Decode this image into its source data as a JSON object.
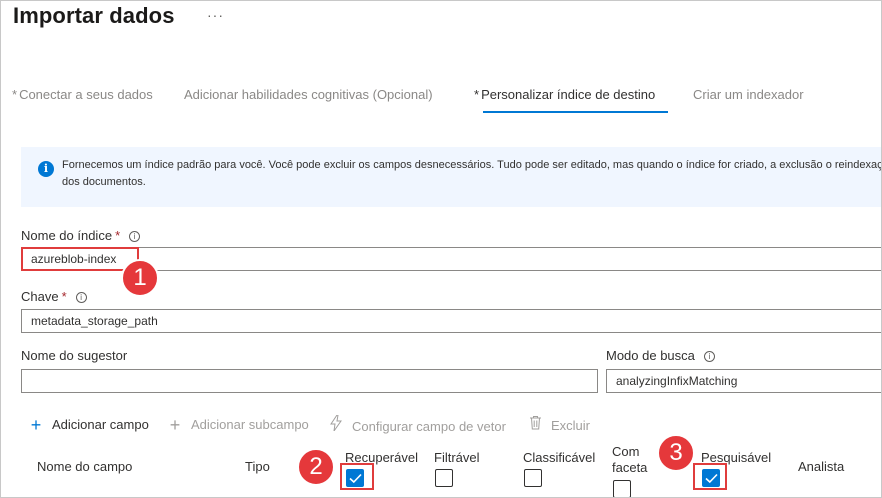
{
  "header": {
    "title": "Importar dados",
    "more_label": "···"
  },
  "steps": [
    {
      "label": "Conectar a seus dados",
      "required_mark": "*",
      "active": false
    },
    {
      "label": "Adicionar habilidades cognitivas (Opcional)",
      "active": false
    },
    {
      "label": "Personalizar índice de destino",
      "required_mark": "*",
      "active": true
    },
    {
      "label": "Criar um indexador",
      "active": false
    }
  ],
  "info_banner": {
    "icon": "info-icon",
    "icon_glyph": "i",
    "text": "Fornecemos um índice padrão para você. Você pode excluir os campos desnecessários. Tudo pode ser editado, mas quando o índice for criado, a exclusão o reindexação dos documentos."
  },
  "form": {
    "index_name": {
      "label": "Nome do índice",
      "required_mark": "*",
      "info_glyph": "i",
      "value": "azureblob-index"
    },
    "key": {
      "label": "Chave",
      "required_mark": "*",
      "info_glyph": "i",
      "value": "metadata_storage_path"
    },
    "suggester": {
      "label": "Nome do sugestor",
      "value": ""
    },
    "search_mode": {
      "label": "Modo de busca",
      "info_glyph": "i",
      "value": "analyzingInfixMatching"
    }
  },
  "toolbar": {
    "add_field": "Adicionar campo",
    "add_subfield": "Adicionar subcampo",
    "configure_vector": "Configurar campo de vetor",
    "delete": "Excluir",
    "plus_glyph": "+"
  },
  "table": {
    "columns": {
      "field_name": "Nome do campo",
      "type": "Tipo",
      "retrievable": "Recuperável",
      "filterable": "Filtrável",
      "sortable": "Classificável",
      "facetable_line1": "Com",
      "facetable_line2": "faceta",
      "searchable": "Pesquisável",
      "analyzer": "Analista"
    },
    "header_checkboxes": {
      "retrievable": true,
      "filterable": false,
      "sortable": false,
      "facetable": false,
      "searchable": true
    }
  },
  "annotations": {
    "badge1": "1",
    "badge2": "2",
    "badge3": "3"
  },
  "colors": {
    "accent": "#0078d4",
    "annotation_red": "#e5383b",
    "info_bg": "#f0f6ff",
    "required": "#a4262c"
  }
}
